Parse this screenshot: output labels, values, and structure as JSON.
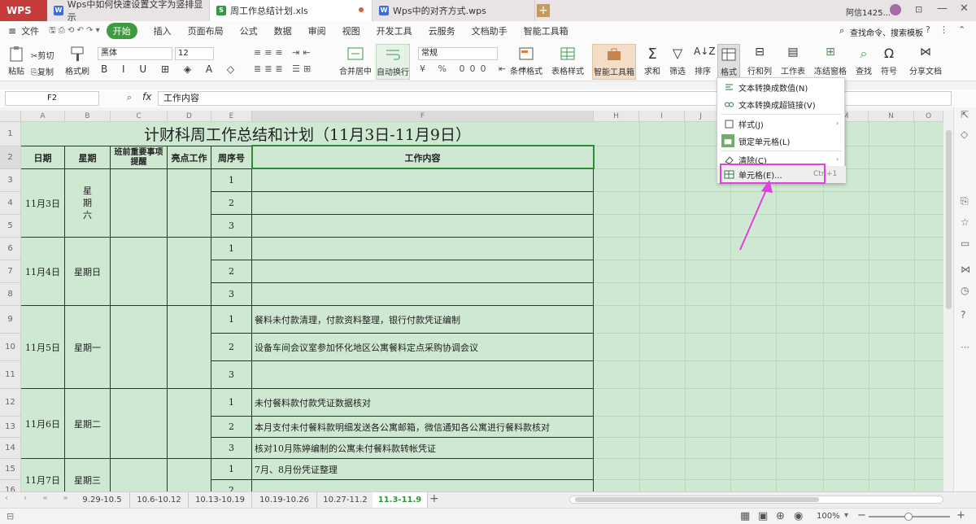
{
  "tabs": {
    "app": "WPS",
    "tab1": "Wps中如何快速设置文字为竖排显示",
    "tab2": "周工作总结计划.xls",
    "tab3": "Wps中的对齐方式.wps",
    "user": "阿信1425..."
  },
  "menu": {
    "file": "文件",
    "items": [
      "开始",
      "插入",
      "页面布局",
      "公式",
      "数据",
      "审阅",
      "视图",
      "开发工具",
      "云服务",
      "文档助手",
      "智能工具箱"
    ],
    "search": "查找命令、搜索模板"
  },
  "ribbon": {
    "paste": "粘贴",
    "cut": "剪切",
    "copy": "复制",
    "format_painter": "格式刷",
    "font": "黑体",
    "size": "12",
    "merge": "合并居中",
    "wrap": "自动换行",
    "numfmt": "常规",
    "cond": "条件格式",
    "table_style": "表格样式",
    "smart_tools": "智能工具箱",
    "sum": "求和",
    "filter": "筛选",
    "sort": "排序",
    "format": "格式",
    "rowcol": "行和列",
    "worksheet": "工作表",
    "freeze": "冻结窗格",
    "find": "查找",
    "symbol": "符号",
    "share": "分享文档"
  },
  "formula_bar": {
    "name_box": "F2",
    "fx": "fx",
    "value": "工作内容"
  },
  "columns": [
    "A",
    "B",
    "C",
    "D",
    "E",
    "F",
    "H",
    "I",
    "J",
    "M",
    "N",
    "O"
  ],
  "sheet": {
    "title": "计财科周工作总结和计划（11月3日-11月9日）",
    "headers": [
      "日期",
      "星期",
      "班前重要事项提醒",
      "亮点工作",
      "周序号",
      "工作内容"
    ],
    "rows": [
      {
        "date": "11月3日",
        "weekday": "星期六",
        "items": [
          "",
          "",
          ""
        ]
      },
      {
        "date": "11月4日",
        "weekday": "星期日",
        "items": [
          "",
          "",
          ""
        ]
      },
      {
        "date": "11月5日",
        "weekday": "星期一",
        "items": [
          "餐料未付款清理，付款资料整理，银行付款凭证编制",
          "设备车间会议室参加怀化地区公寓餐料定点采购协调会议",
          ""
        ]
      },
      {
        "date": "11月6日",
        "weekday": "星期二",
        "items": [
          "未付餐料款付款凭证数据核对",
          "本月支付未付餐料款明细发送各公寓邮箱，微信通知各公寓进行餐料款核对",
          "核对10月陈婷编制的公寓未付餐料款转帐凭证"
        ]
      },
      {
        "date": "11月7日",
        "weekday": "星期三",
        "items": [
          "7月、8月份凭证整理",
          ""
        ]
      }
    ],
    "seq": [
      "1",
      "2",
      "3"
    ]
  },
  "context_menu": {
    "items": [
      {
        "label": "文本转换成数值(N)",
        "shortcut": ""
      },
      {
        "label": "文本转换成超链接(V)",
        "shortcut": ""
      },
      {
        "label": "样式(J)",
        "shortcut": ""
      },
      {
        "label": "锁定单元格(L)",
        "shortcut": ""
      },
      {
        "label": "清除(C)",
        "shortcut": ""
      },
      {
        "label": "单元格(E)...",
        "shortcut": "Ctrl+1"
      }
    ]
  },
  "sheet_tabs": [
    "9.29-10.5",
    "10.6-10.12",
    "10.13-10.19",
    "10.19-10.26",
    "10.27-11.2",
    "11.3-11.9"
  ],
  "status": {
    "zoom": "100%"
  },
  "colors": {
    "accent_green": "#3f9b3f",
    "grid_bg": "#cfe8d2",
    "highlight_magenta": "#e040e0"
  }
}
